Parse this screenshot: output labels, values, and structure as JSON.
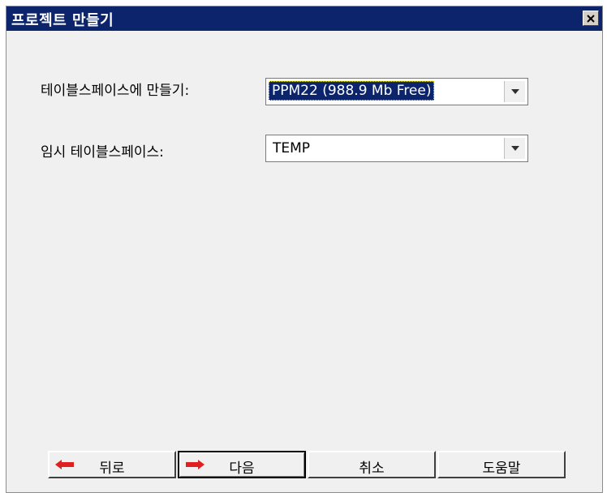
{
  "window": {
    "title": "프로젝트 만들기"
  },
  "form": {
    "tablespace_label": "테이블스페이스에 만들기:",
    "tablespace_value": "PPM22 (988.9 Mb Free)",
    "temp_tablespace_label": "임시 테이블스페이스:",
    "temp_tablespace_value": "TEMP"
  },
  "buttons": {
    "back_label": "뒤로",
    "next_label": "다음",
    "cancel_label": "취소",
    "help_label": "도움말"
  },
  "icons": {
    "close": "close-icon",
    "dropdown": "chevron-down-icon",
    "back": "arrow-left-icon",
    "next": "arrow-right-icon"
  },
  "colors": {
    "titlebar": "#0b246b",
    "arrow_red": "#e02020",
    "selection": "#0b246b"
  }
}
